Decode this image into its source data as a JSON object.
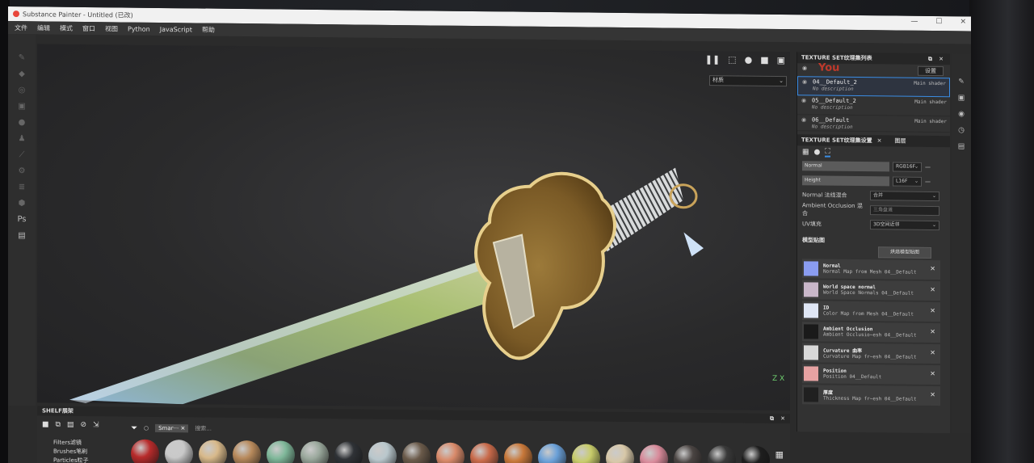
{
  "window": {
    "title": "Substance Painter - Untitled (已改)",
    "controls": [
      "—",
      "☐",
      "✕"
    ]
  },
  "menu": [
    "文件",
    "编辑",
    "模式",
    "窗口",
    "视图",
    "Python",
    "JavaScript",
    "帮助"
  ],
  "viewport": {
    "toolbar_icons": [
      "pause-icon",
      "camera-icon",
      "sphere-icon",
      "video-icon",
      "screenshot-icon"
    ],
    "material_select": "材质",
    "axis_label": "Z X"
  },
  "texture_set_list": {
    "title": "TEXTURE SET纹理集列表",
    "settings_label": "设置",
    "watermark": "You",
    "items": [
      {
        "name": "04__Default_2",
        "desc": "No description",
        "shader": "Main shader",
        "selected": true
      },
      {
        "name": "05__Default_2",
        "desc": "No description",
        "shader": "Main shader",
        "selected": false
      },
      {
        "name": "06__Default",
        "desc": "No description",
        "shader": "Main shader",
        "selected": false
      }
    ]
  },
  "texture_set_settings": {
    "title": "TEXTURE SET纹理集设置",
    "tab2": "图层",
    "channels": [
      {
        "name": "Normal",
        "format": "RGB16F"
      },
      {
        "name": "Height",
        "format": "L16F"
      }
    ],
    "props": [
      {
        "label": "Normal 法线混合",
        "value": "合并"
      },
      {
        "label": "Ambient Occlusion 混合",
        "value": "三角盘道"
      },
      {
        "label": "UV填充",
        "value": "3D空间近邻"
      }
    ],
    "mesh_maps_title": "模型贴图",
    "bake_button": "烘焙模型贴图",
    "mesh_maps": [
      {
        "name": "Normal",
        "sub": "Normal Map from Mesh 04__Default",
        "color": "#8a9cf0"
      },
      {
        "name": "World space normal",
        "sub": "World Space Normals 04__Default",
        "color": "#c9b7c9"
      },
      {
        "name": "ID",
        "sub": "Color Map from Mesh 04__Default",
        "color": "#dfe6f5"
      },
      {
        "name": "Ambient Occlusion",
        "sub": "Ambient Occlusio~esh 04__Default",
        "color": "#1a1a1a"
      },
      {
        "name": "Curvature 曲率",
        "sub": "Curvature Map fr~esh 04__Default",
        "color": "#d8d8d8"
      },
      {
        "name": "Position",
        "sub": "Position 04__Default",
        "color": "#e6a2a2"
      },
      {
        "name": "厚度",
        "sub": "Thickness Map fr~esh 04__Default",
        "color": "#202020"
      }
    ]
  },
  "shelf": {
    "title": "SHELF展架",
    "tab": "Smar···",
    "search_placeholder": "搜索...",
    "categories": [
      "Filters滤镜",
      "Brushes笔刷",
      "Particles粒子"
    ],
    "materials": [
      "#b82b2b",
      "#c9c9c9",
      "#d8b98a",
      "#b88a5c",
      "#7fb89a",
      "#9aa89c",
      "#2f3236",
      "#b9c7cc",
      "#6a5a4a",
      "#d98a6a",
      "#c96a4a",
      "#c8783a",
      "#6aa0d8",
      "#c8cc6a",
      "#d8c8a8",
      "#d88a9a",
      "#4a4442",
      "#3a3a3a",
      "#1e1e1e"
    ]
  }
}
